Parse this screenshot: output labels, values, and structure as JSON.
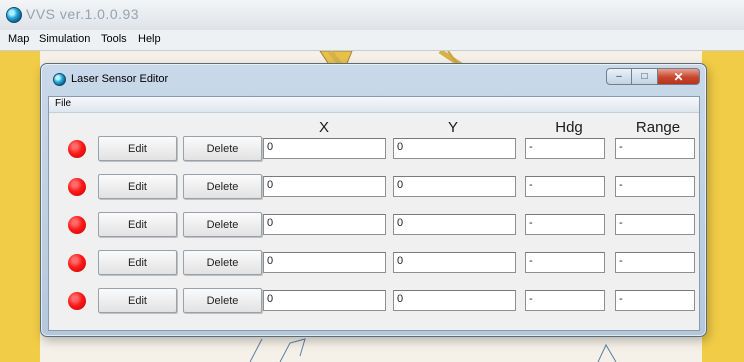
{
  "app": {
    "title": "VVS ver.1.0.0.93",
    "menu": [
      "Map",
      "Simulation",
      "Tools",
      "Help"
    ]
  },
  "dialog": {
    "title": "Laser Sensor Editor",
    "menu": [
      "File"
    ],
    "window_buttons": {
      "minimize": "–",
      "maximize": "□",
      "close": "✕"
    },
    "columns": {
      "x": "X",
      "y": "Y",
      "hdg": "Hdg",
      "range": "Range"
    },
    "edit_label": "Edit",
    "delete_label": "Delete",
    "rows": [
      {
        "status_color": "#ff1a1a",
        "x": "0",
        "y": "0",
        "hdg": "-",
        "range": "-"
      },
      {
        "status_color": "#ff1a1a",
        "x": "0",
        "y": "0",
        "hdg": "-",
        "range": "-"
      },
      {
        "status_color": "#ff1a1a",
        "x": "0",
        "y": "0",
        "hdg": "-",
        "range": "-"
      },
      {
        "status_color": "#ff1a1a",
        "x": "0",
        "y": "0",
        "hdg": "-",
        "range": "-"
      },
      {
        "status_color": "#ff1a1a",
        "x": "0",
        "y": "0",
        "hdg": "-",
        "range": "-"
      }
    ]
  },
  "colors": {
    "land": "#f1cc46",
    "status_led": "#ff1a1a"
  }
}
